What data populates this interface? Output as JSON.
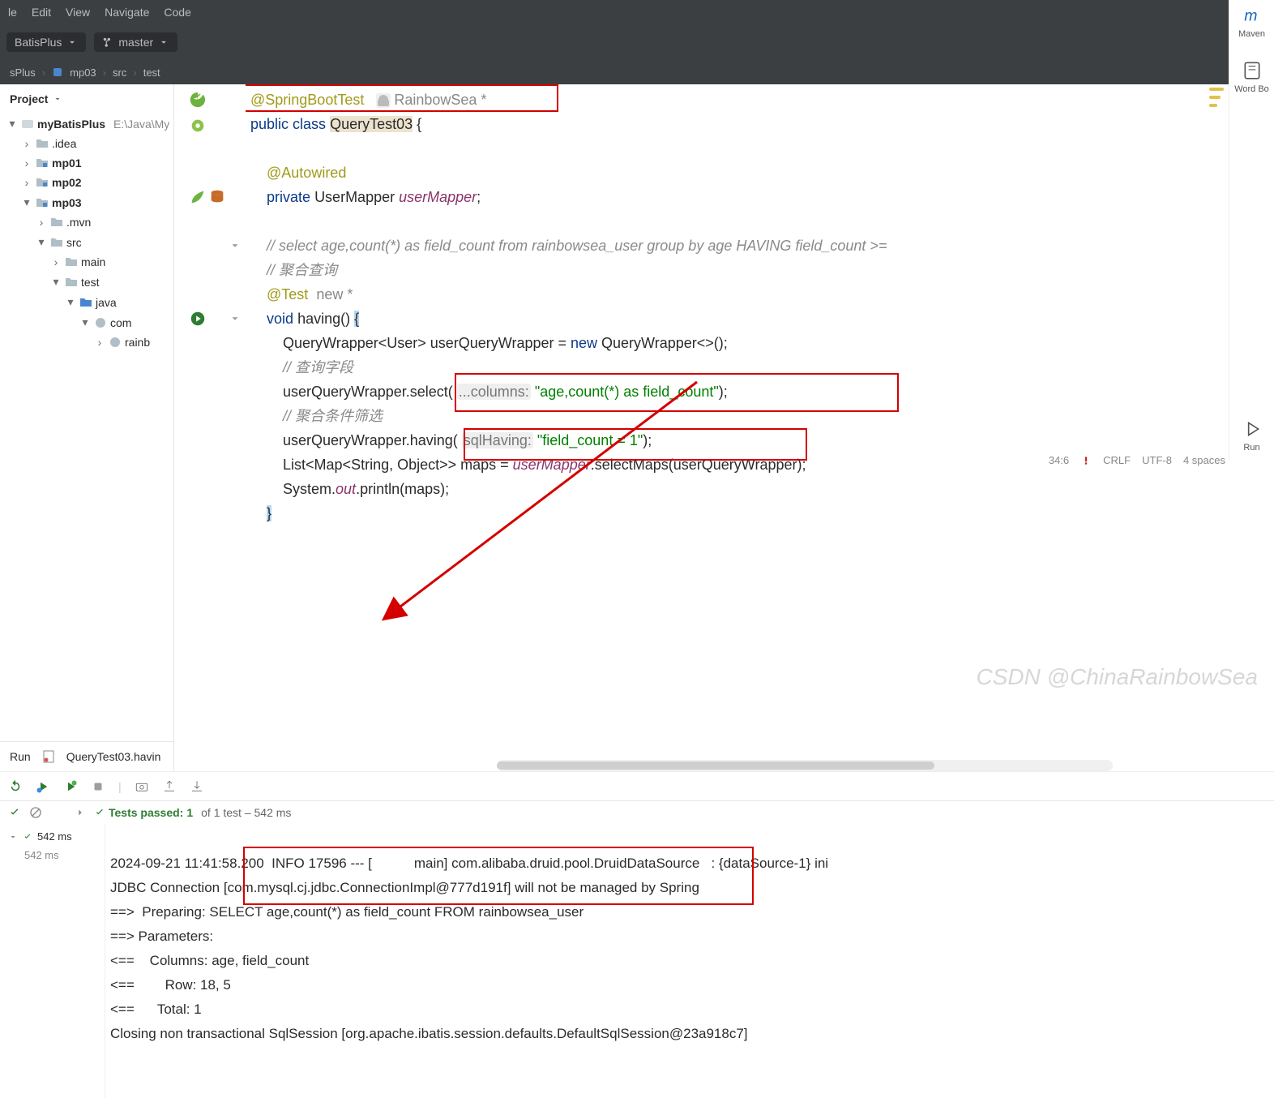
{
  "menu": {
    "items": [
      "le",
      "Edit",
      "View",
      "Navigate",
      "Code"
    ]
  },
  "toolbar": {
    "project": "BatisPlus",
    "branch": "master"
  },
  "breadcrumbs": {
    "segments": [
      "sPlus",
      "mp03",
      "src",
      "test"
    ]
  },
  "sidebar": {
    "title": "Project",
    "root": {
      "name": "myBatisPlus",
      "path": "E:\\Java\\My"
    },
    "tree": [
      {
        "d": 1,
        "open": null,
        "name": ".idea",
        "kind": "folder"
      },
      {
        "d": 1,
        "open": null,
        "name": "mp01",
        "kind": "module",
        "bold": true
      },
      {
        "d": 1,
        "open": null,
        "name": "mp02",
        "kind": "module",
        "bold": true
      },
      {
        "d": 1,
        "open": true,
        "name": "mp03",
        "kind": "module",
        "bold": true
      },
      {
        "d": 2,
        "open": null,
        "name": ".mvn",
        "kind": "folder"
      },
      {
        "d": 2,
        "open": true,
        "name": "src",
        "kind": "folder"
      },
      {
        "d": 3,
        "open": null,
        "name": "main",
        "kind": "folder"
      },
      {
        "d": 3,
        "open": true,
        "name": "test",
        "kind": "folder"
      },
      {
        "d": 4,
        "open": true,
        "name": "java",
        "kind": "src"
      },
      {
        "d": 5,
        "open": true,
        "name": "com",
        "kind": "pkg"
      },
      {
        "d": 6,
        "open": null,
        "name": "rainb",
        "kind": "pkg"
      }
    ],
    "runtab": {
      "label": "Run",
      "file": "QueryTest03.havin"
    }
  },
  "code": {
    "header_ann": "@SpringBootTest",
    "author_label": "RainbowSea *",
    "l2_kw1": "public",
    "l2_kw2": "class",
    "l2_name": "QueryTest03",
    "l2_brace": "{",
    "l4": "@Autowired",
    "l5_kw": "private",
    "l5_type": "UserMapper",
    "l5_field": "userMapper",
    "l5_end": ";",
    "l7": "// select age,count(*) as field_count from rainbowsea_user group by age HAVING field_count >=",
    "l8": "// 聚合查询",
    "l9_ann": "@Test",
    "l9_new": "new *",
    "l10_kw": "void",
    "l10_name": "having",
    "l10_rest": "() ",
    "l10_brace": "{",
    "l11_a": "QueryWrapper<User> userQueryWrapper = ",
    "l11_new": "new",
    "l11_b": " QueryWrapper<>();",
    "l12": "// 查询字段",
    "l13_a": "userQueryWrapper.select( ",
    "l13_param": "...columns:",
    "l13_str": "\"age,count(*) as field_count\"",
    "l13_end": ");",
    "l14": "// 聚合条件筛选",
    "l15_a": "userQueryWrapper.having( ",
    "l15_param": "sqlHaving:",
    "l15_str": "\"field_count = 1\"",
    "l15_end": ");",
    "l16_a": "List<Map<String, Object>> maps = ",
    "l16_u": "userMapper",
    "l16_b": ".selectMaps(userQueryWrapper);",
    "l17_a": "System.",
    "l17_out": "out",
    "l17_b": ".println(maps);",
    "l18": "}"
  },
  "status": {
    "pos": "34:6",
    "eol": "CRLF",
    "enc": "UTF-8",
    "indent": "4 spaces"
  },
  "rightrail": {
    "maven": "Maven",
    "wordbook": "Word Bo",
    "run": "Run"
  },
  "tests": {
    "passed_label": "Tests passed:",
    "passed_count": "1",
    "passed_of": "of 1 test – 542 ms",
    "item_ms": "542 ms",
    "sub_ms": "542 ms"
  },
  "console": {
    "l1": "2024-09-21 11:41:58.200  INFO 17596 --- [           main] com.alibaba.druid.pool.DruidDataSource   : {dataSource-1} ini",
    "l2": "JDBC Connection [com.mysql.cj.jdbc.ConnectionImpl@777d191f] will not be managed by Spring",
    "l3": "==>  Preparing: SELECT age,count(*) as field_count FROM rainbowsea_user",
    "l4": "==> Parameters:",
    "l5": "<==    Columns: age, field_count",
    "l6": "<==        Row: 18, 5",
    "l7": "<==      Total: 1",
    "l8": "Closing non transactional SqlSession [org.apache.ibatis.session.defaults.DefaultSqlSession@23a918c7]"
  },
  "watermark": "CSDN @ChinaRainbowSea"
}
